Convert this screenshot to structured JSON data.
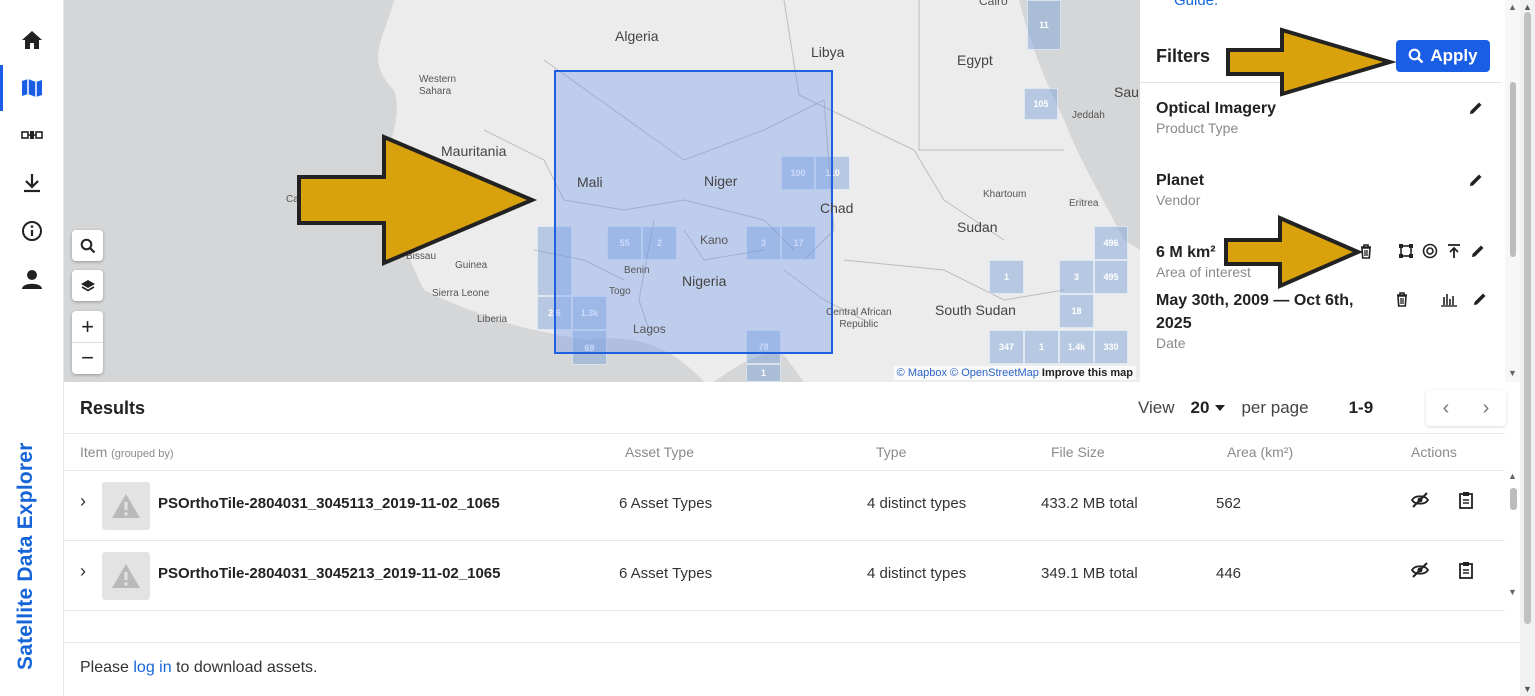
{
  "app": {
    "brand": "Satellite Data Explorer"
  },
  "sidebar": {
    "items": [
      {
        "name": "home",
        "icon": "home-icon"
      },
      {
        "name": "map",
        "icon": "map-icon",
        "active": true
      },
      {
        "name": "satellite",
        "icon": "satellite-icon"
      },
      {
        "name": "download",
        "icon": "download-icon"
      },
      {
        "name": "info",
        "icon": "info-icon"
      },
      {
        "name": "account",
        "icon": "user-icon"
      }
    ]
  },
  "map": {
    "labels": {
      "algeria": "Algeria",
      "libya": "Libya",
      "egypt": "Egypt",
      "western_sahara": "Western\nSahara",
      "mauritania": "Mauritania",
      "mali": "Mali",
      "niger": "Niger",
      "chad": "Chad",
      "sudan": "Sudan",
      "khartoum": "Khartoum",
      "eritrea": "Eritrea",
      "jeddah": "Jeddah",
      "cairo": "Cairo",
      "sau": "Sau",
      "nigeria": "Nigeria",
      "kano": "Kano",
      "benin": "Benin",
      "togo": "Togo",
      "guinea": "Guinea",
      "bissau": "Bissau",
      "sierra_leone": "Sierra Leone",
      "liberia": "Liberia",
      "lagos": "Lagos",
      "car": "Central African\nRepublic",
      "south_sudan": "South Sudan",
      "cap": "Cap"
    },
    "tiles": [
      "11",
      "105",
      "100",
      "110",
      "55",
      "2",
      "3",
      "17",
      "496",
      "1",
      "3",
      "495",
      "2.6",
      "1.3k",
      "18",
      "69",
      "78",
      "1",
      "347",
      "1",
      "1.4k",
      "330"
    ],
    "attribution": {
      "mapbox": "© Mapbox",
      "osm": "© OpenStreetMap",
      "improve": "Improve this map"
    }
  },
  "filters": {
    "guide": "Guide.",
    "title": "Filters",
    "apply_label": "Apply",
    "items": [
      {
        "value": "Optical Imagery",
        "label": "Product Type"
      },
      {
        "value": "Planet",
        "label": "Vendor"
      },
      {
        "value": "6 M km²",
        "label": "Area of interest"
      },
      {
        "value": "May 30th, 2009 — Oct 6th, 2025",
        "label": "Date"
      }
    ]
  },
  "results": {
    "title": "Results",
    "view_label": "View",
    "per_page_value": "20",
    "per_page_label": "per page",
    "range": "1-9",
    "columns": {
      "item": "Item",
      "grouped_by": "(grouped by)",
      "asset_type": "Asset Type",
      "type": "Type",
      "file_size": "File Size",
      "area": "Area (km²)",
      "actions": "Actions"
    },
    "rows": [
      {
        "name": "PSOrthoTile-2804031_3045113_2019-11-02_1065",
        "asset_type": "6 Asset Types",
        "type": "4 distinct types",
        "file_size": "433.2 MB total",
        "area": "562"
      },
      {
        "name": "PSOrthoTile-2804031_3045213_2019-11-02_1065",
        "asset_type": "6 Asset Types",
        "type": "4 distinct types",
        "file_size": "349.1 MB total",
        "area": "446"
      }
    ]
  },
  "footer": {
    "prefix": "Please",
    "link": "log in",
    "suffix": "to download assets."
  },
  "colors": {
    "accent": "#1a5ee6",
    "brand": "#1565d8",
    "arrow": "#d9a20c"
  }
}
